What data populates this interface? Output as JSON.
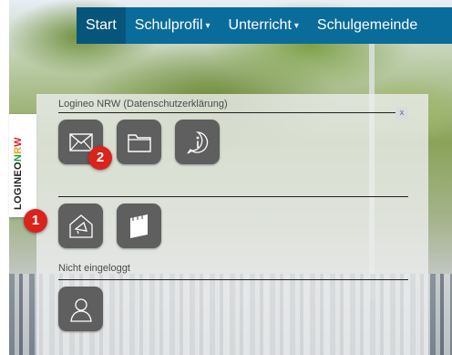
{
  "nav": {
    "items": [
      {
        "label": "Start",
        "active": true
      },
      {
        "label": "Schulprofil",
        "caret": "▾"
      },
      {
        "label": "Unterricht",
        "caret": "▾"
      },
      {
        "label": "Schulgemeinde",
        "caret": ""
      }
    ]
  },
  "logineo": {
    "tab_text": "LOGINEO",
    "nrw_letters": [
      "N",
      "R",
      "W"
    ]
  },
  "panel": {
    "section1_title": "Logineo NRW (Datenschutzerklärung)",
    "section1_tiles": [
      {
        "icon": "mail-icon"
      },
      {
        "icon": "folder-icon"
      },
      {
        "icon": "info-icon"
      }
    ],
    "section2_tiles": [
      {
        "icon": "megaphone-icon"
      },
      {
        "icon": "notes-icon"
      }
    ],
    "section3_title": "Nicht eingeloggt",
    "section3_tiles": [
      {
        "icon": "user-icon"
      }
    ],
    "close_label": "x"
  },
  "badges": [
    "1",
    "2"
  ],
  "colors": {
    "nav_bg": "#0a6c9b",
    "nav_active": "#07557a",
    "tile_bg": "#5f5f5f",
    "badge": "#d9231c"
  }
}
